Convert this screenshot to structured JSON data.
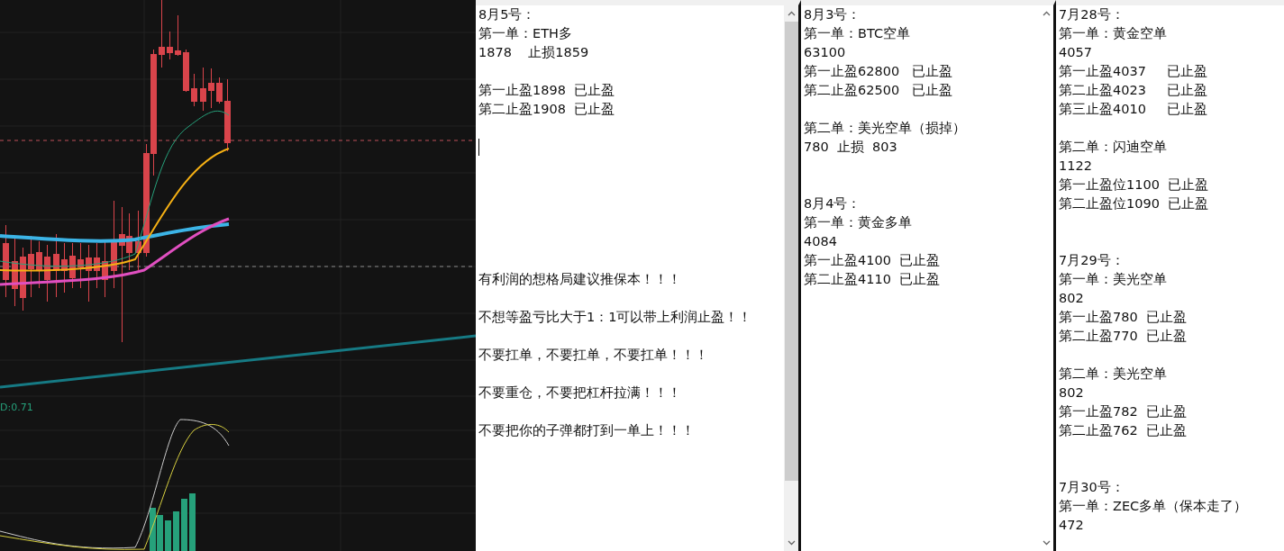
{
  "chart": {
    "indicator_label": "D:0.71"
  },
  "panes": [
    {
      "scrollbar": true,
      "lines": [
        {
          "kind": "text",
          "text": "8月5号："
        },
        {
          "kind": "text",
          "text": "第一单：ETH多"
        },
        {
          "kind": "text",
          "text": "1878    止损1859"
        },
        {
          "kind": "blank"
        },
        {
          "kind": "text",
          "text": "第一止盈1898  已止盈"
        },
        {
          "kind": "text",
          "text": "第二止盈1908  已止盈"
        },
        {
          "kind": "blank"
        },
        {
          "kind": "caret"
        },
        {
          "kind": "blank"
        },
        {
          "kind": "blank"
        },
        {
          "kind": "blank"
        },
        {
          "kind": "blank"
        },
        {
          "kind": "blank"
        },
        {
          "kind": "blank"
        },
        {
          "kind": "text",
          "text": "有利润的想格局建议推保本！！！"
        },
        {
          "kind": "blank"
        },
        {
          "kind": "text",
          "text": "不想等盈亏比大于1：1可以带上利润止盈！！"
        },
        {
          "kind": "blank"
        },
        {
          "kind": "text",
          "text": "不要扛单，不要扛单，不要扛单！！！"
        },
        {
          "kind": "blank"
        },
        {
          "kind": "text",
          "text": "不要重仓，不要把杠杆拉满！！！"
        },
        {
          "kind": "blank"
        },
        {
          "kind": "text",
          "text": "不要把你的子弹都打到一单上！！！"
        }
      ]
    },
    {
      "scrollbar": true,
      "lines": [
        {
          "kind": "text",
          "text": "8月3号："
        },
        {
          "kind": "text",
          "text": "第一单：BTC空单"
        },
        {
          "kind": "text",
          "text": "63100"
        },
        {
          "kind": "text",
          "text": "第一止盈62800   已止盈"
        },
        {
          "kind": "text",
          "text": "第二止盈62500   已止盈"
        },
        {
          "kind": "blank"
        },
        {
          "kind": "text",
          "text": "第二单：美光空单（损掉）"
        },
        {
          "kind": "text",
          "text": "780  止损  803"
        },
        {
          "kind": "blank"
        },
        {
          "kind": "blank"
        },
        {
          "kind": "text",
          "text": "8月4号："
        },
        {
          "kind": "text",
          "text": "第一单：黄金多单"
        },
        {
          "kind": "text",
          "text": "4084"
        },
        {
          "kind": "text",
          "text": "第一止盈4100  已止盈"
        },
        {
          "kind": "text",
          "text": "第二止盈4110  已止盈"
        }
      ]
    },
    {
      "scrollbar": false,
      "lines": [
        {
          "kind": "text",
          "text": "7月28号："
        },
        {
          "kind": "text",
          "text": "第一单：黄金空单"
        },
        {
          "kind": "text",
          "text": "4057"
        },
        {
          "kind": "text",
          "text": "第一止盈4037     已止盈"
        },
        {
          "kind": "text",
          "text": "第二止盈4023     已止盈"
        },
        {
          "kind": "text",
          "text": "第三止盈4010     已止盈"
        },
        {
          "kind": "blank"
        },
        {
          "kind": "text",
          "text": "第二单：闪迪空单"
        },
        {
          "kind": "text",
          "text": "1122"
        },
        {
          "kind": "text",
          "text": "第一止盈位1100  已止盈"
        },
        {
          "kind": "text",
          "text": "第二止盈位1090  已止盈"
        },
        {
          "kind": "blank"
        },
        {
          "kind": "blank"
        },
        {
          "kind": "text",
          "text": "7月29号："
        },
        {
          "kind": "text",
          "text": "第一单：美光空单"
        },
        {
          "kind": "text",
          "text": "802"
        },
        {
          "kind": "text",
          "text": "第一止盈780  已止盈"
        },
        {
          "kind": "text",
          "text": "第二止盈770  已止盈"
        },
        {
          "kind": "blank"
        },
        {
          "kind": "text",
          "text": "第二单：美光空单"
        },
        {
          "kind": "text",
          "text": "802"
        },
        {
          "kind": "text",
          "text": "第一止盈782  已止盈"
        },
        {
          "kind": "text",
          "text": "第二止盈762  已止盈"
        },
        {
          "kind": "blank"
        },
        {
          "kind": "blank"
        },
        {
          "kind": "text",
          "text": "7月30号："
        },
        {
          "kind": "text",
          "text": "第一单：ZEC多单（保本走了）"
        },
        {
          "kind": "text",
          "text": "472"
        }
      ]
    }
  ]
}
